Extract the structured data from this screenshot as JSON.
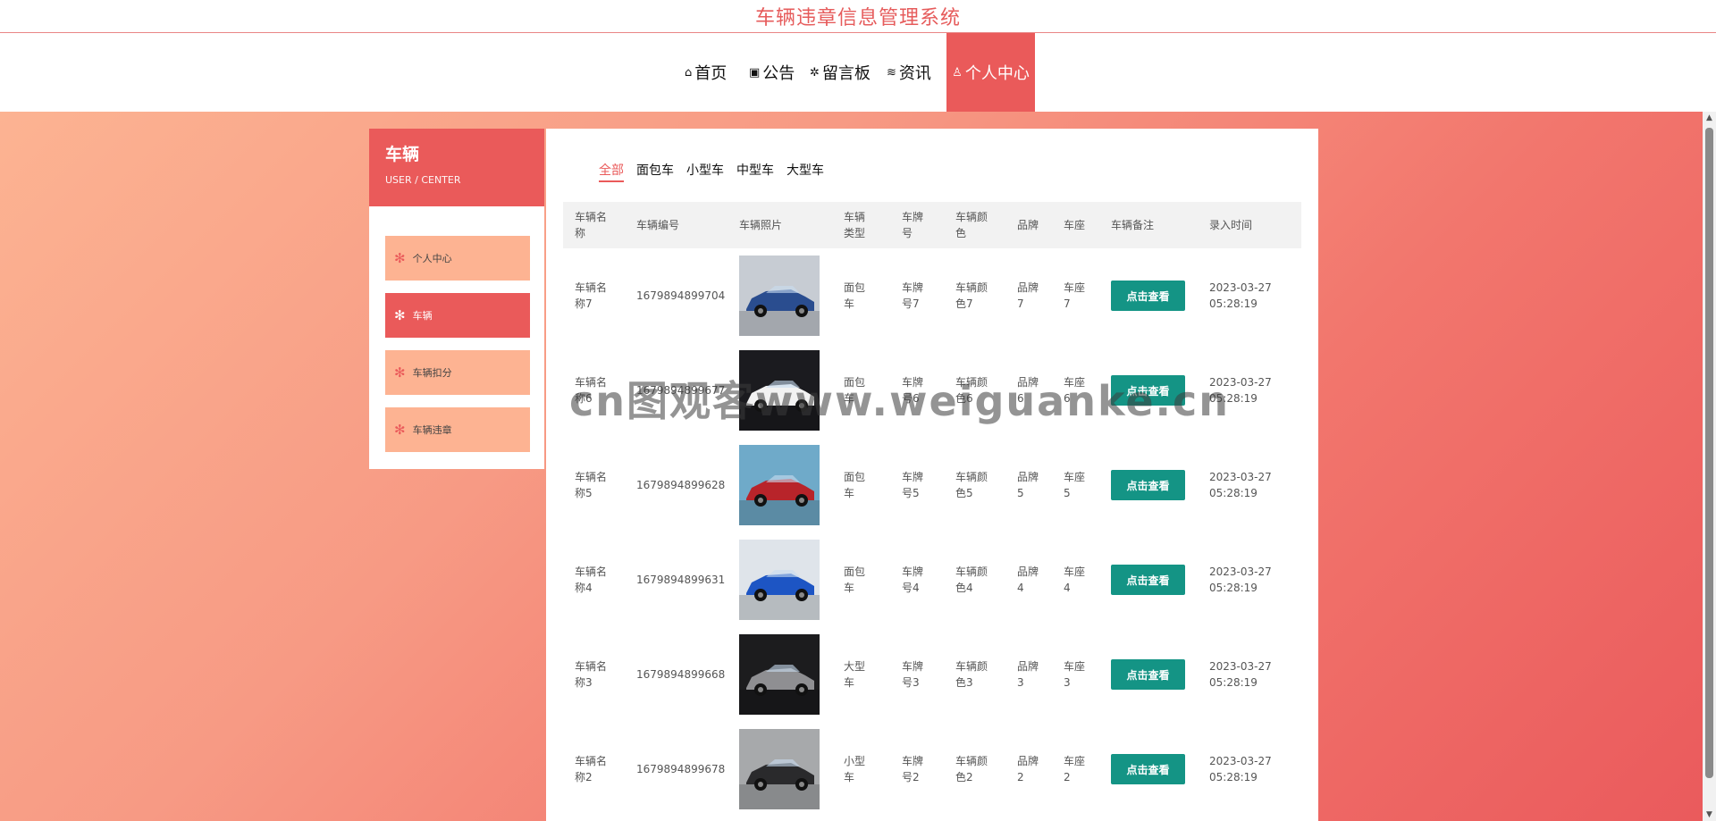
{
  "site": {
    "title": "车辆违章信息管理系统"
  },
  "nav": [
    {
      "icon": "home-icon",
      "glyph": "⌂",
      "label": "首页"
    },
    {
      "icon": "gift-icon",
      "glyph": "▣",
      "label": "公告"
    },
    {
      "icon": "message-icon",
      "glyph": "✲",
      "label": "留言板"
    },
    {
      "icon": "layers-icon",
      "glyph": "≋",
      "label": "资讯"
    },
    {
      "icon": "user-icon",
      "glyph": "♙",
      "label": "个人中心"
    }
  ],
  "sidebar": {
    "title": "车辆",
    "subtitle": "USER / CENTER",
    "items": [
      {
        "label": "个人中心"
      },
      {
        "label": "车辆"
      },
      {
        "label": "车辆扣分"
      },
      {
        "label": "车辆违章"
      }
    ]
  },
  "tabs": [
    "全部",
    "面包车",
    "小型车",
    "中型车",
    "大型车"
  ],
  "table": {
    "headers": [
      "车辆名称",
      "车辆编号",
      "车辆照片",
      "车辆类型",
      "车牌号",
      "车辆颜色",
      "品牌",
      "车座",
      "车辆备注",
      "录入时间"
    ],
    "button_label": "点击查看",
    "rows": [
      {
        "name": "车辆名称7",
        "code": "1679894899704",
        "type": "面包车",
        "plate": "车牌号7",
        "color": "车辆颜色7",
        "brand": "品牌7",
        "seat": "车座7",
        "time": "2023-03-27 05:28:19",
        "car_color": "#2a4d8f",
        "bg": "#c7ccd3"
      },
      {
        "name": "车辆名称6",
        "code": "1679894899677",
        "type": "面包车",
        "plate": "车牌号6",
        "color": "车辆颜色6",
        "brand": "品牌6",
        "seat": "车座6",
        "time": "2023-03-27 05:28:19",
        "car_color": "#f2f2f2",
        "bg": "#1b1b1f"
      },
      {
        "name": "车辆名称5",
        "code": "1679894899628",
        "type": "面包车",
        "plate": "车牌号5",
        "color": "车辆颜色5",
        "brand": "品牌5",
        "seat": "车座5",
        "time": "2023-03-27 05:28:19",
        "car_color": "#b8242a",
        "bg": "#6faac9"
      },
      {
        "name": "车辆名称4",
        "code": "1679894899631",
        "type": "面包车",
        "plate": "车牌号4",
        "color": "车辆颜色4",
        "brand": "品牌4",
        "seat": "车座4",
        "time": "2023-03-27 05:28:19",
        "car_color": "#1d55c4",
        "bg": "#dfe4ea"
      },
      {
        "name": "车辆名称3",
        "code": "1679894899668",
        "type": "大型车",
        "plate": "车牌号3",
        "color": "车辆颜色3",
        "brand": "品牌3",
        "seat": "车座3",
        "time": "2023-03-27 05:28:19",
        "car_color": "#8f8f92",
        "bg": "#1c1c1e"
      },
      {
        "name": "车辆名称2",
        "code": "1679894899678",
        "type": "小型车",
        "plate": "车牌号2",
        "color": "车辆颜色2",
        "brand": "品牌2",
        "seat": "车座2",
        "time": "2023-03-27 05:28:19",
        "car_color": "#2a2a2c",
        "bg": "#a7a9ab"
      }
    ]
  },
  "watermark": "cn图观客www.weiguanke.cn",
  "colors": {
    "accent": "#ea5a5a",
    "button": "#149485",
    "sidebar_item": "#fdb392"
  }
}
